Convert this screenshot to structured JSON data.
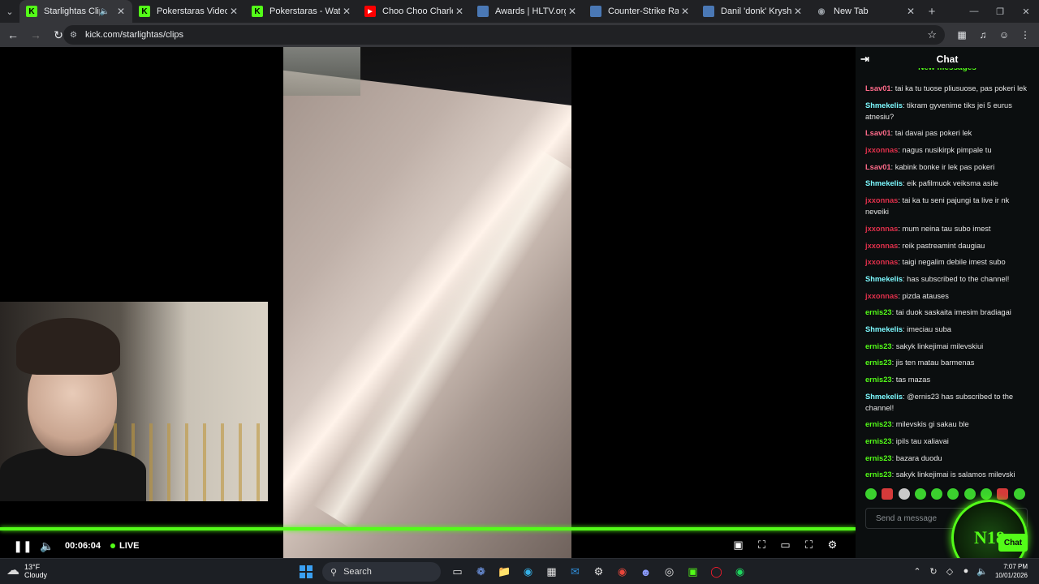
{
  "browser": {
    "tabs": [
      {
        "title": "Starlightas Clips - Wa",
        "favicon": "kick-icon",
        "color": "#53fc18",
        "active": true,
        "audio": true
      },
      {
        "title": "Pokerstaras Videos - Wat",
        "favicon": "kick-icon",
        "color": "#53fc18",
        "active": false
      },
      {
        "title": "Pokerstaras - Watch the V",
        "favicon": "kick-icon",
        "color": "#53fc18",
        "active": false
      },
      {
        "title": "Choo Choo Charles | KILL",
        "favicon": "youtube-icon",
        "color": "#ff0000",
        "active": false
      },
      {
        "title": "Awards | HLTV.org",
        "favicon": "hltv-icon",
        "color": "#4a78b5",
        "active": false
      },
      {
        "title": "Counter-Strike Ranking |",
        "favicon": "hltv-icon",
        "color": "#4a78b5",
        "active": false
      },
      {
        "title": "Danil 'donk' Kryshkovets",
        "favicon": "hltv-icon",
        "color": "#4a78b5",
        "active": false
      },
      {
        "title": "New Tab",
        "favicon": "chrome-icon",
        "color": "#9aa0a6",
        "active": false
      }
    ],
    "url": "kick.com/starlightas/clips"
  },
  "player": {
    "time": "00:06:04",
    "live_label": "LIVE",
    "progress": 1.0,
    "accent": "#53fc18"
  },
  "chat": {
    "title": "Chat",
    "new_messages_label": "New messages",
    "messages": [
      {
        "user": "Lsav01",
        "color": "#ff6b8a",
        "text": "tai ka tu tuose pliusuose, pas pokeri lek"
      },
      {
        "user": "Shmekelis",
        "color": "#7df9ff",
        "text": "tikram gyvenime tiks jei 5 eurus atnesiu?"
      },
      {
        "user": "Lsav01",
        "color": "#ff6b8a",
        "text": "tai davai pas pokeri lek"
      },
      {
        "user": "jxxonnas",
        "color": "#e0304b",
        "text": "nagus nusikirpk pimpale tu"
      },
      {
        "user": "Lsav01",
        "color": "#ff6b8a",
        "text": "kabink bonke ir lek pas pokeri"
      },
      {
        "user": "Shmekelis",
        "color": "#7df9ff",
        "text": "eik pafilmuok veiksma asile"
      },
      {
        "user": "jxxonnas",
        "color": "#e0304b",
        "text": "tai ka tu seni pajungi ta live ir nk neveiki"
      },
      {
        "user": "jxxonnas",
        "color": "#e0304b",
        "text": "mum neina tau subo imest"
      },
      {
        "user": "jxxonnas",
        "color": "#e0304b",
        "text": "reik pastreamint daugiau"
      },
      {
        "user": "jxxonnas",
        "color": "#e0304b",
        "text": "taigi negalim debile imest subo"
      },
      {
        "user": "Shmekelis",
        "color": "#7df9ff",
        "text": "has subscribed to the channel!"
      },
      {
        "user": "jxxonnas",
        "color": "#e0304b",
        "text": "pizda atauses"
      },
      {
        "user": "ernis23",
        "color": "#53fc18",
        "text": "tai duok saskaita imesim bradiagai"
      },
      {
        "user": "Shmekelis",
        "color": "#7df9ff",
        "text": "imeciau suba"
      },
      {
        "user": "ernis23",
        "color": "#53fc18",
        "text": "sakyk linkejimai milevskiui"
      },
      {
        "user": "ernis23",
        "color": "#53fc18",
        "text": "jis ten matau barmenas"
      },
      {
        "user": "ernis23",
        "color": "#53fc18",
        "text": "tas mazas"
      },
      {
        "user": "Shmekelis",
        "color": "#7df9ff",
        "text": "@ernis23 has subscribed to the channel!"
      },
      {
        "user": "ernis23",
        "color": "#53fc18",
        "text": "milevskis gi sakau ble"
      },
      {
        "user": "ernis23",
        "color": "#53fc18",
        "text": "ipils tau xaliavai"
      },
      {
        "user": "ernis23",
        "color": "#53fc18",
        "text": "bazara duodu"
      },
      {
        "user": "ernis23",
        "color": "#53fc18",
        "text": "sakyk linkejimai is salamos milevski"
      }
    ],
    "send_placeholder": "Send a message",
    "badge_text": "N18",
    "chat_button": "Chat"
  },
  "taskbar": {
    "temperature": "13°F",
    "weather": "Cloudy",
    "search_label": "Search",
    "time": "7:07 PM",
    "date": "10/01/2026"
  }
}
